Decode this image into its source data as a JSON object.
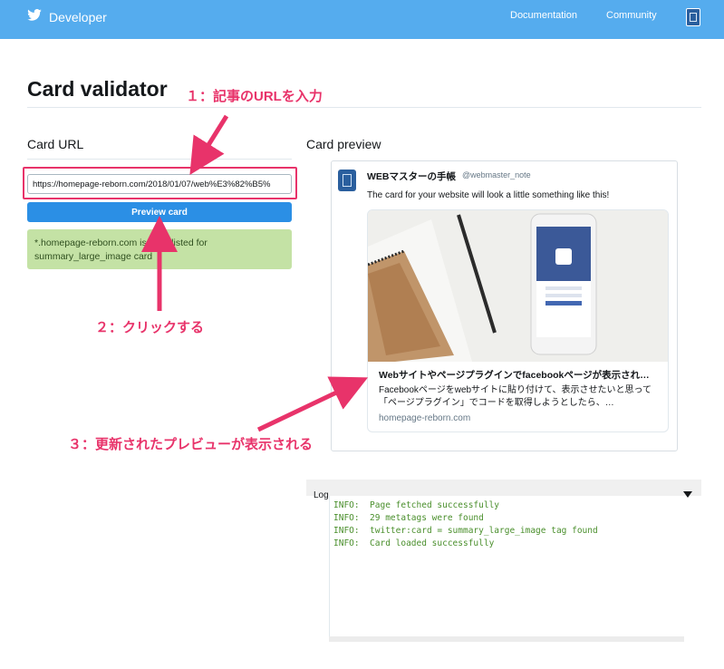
{
  "header": {
    "brand": "Developer",
    "nav": [
      "Documentation",
      "Community"
    ]
  },
  "page_title": "Card validator",
  "left": {
    "section_label": "Card URL",
    "url_value": "https://homepage-reborn.com/2018/01/07/web%E3%82%B5%",
    "button_label": "Preview card",
    "message": "*.homepage-reborn.com is whitelisted for summary_large_image card"
  },
  "right": {
    "section_label": "Card preview",
    "account_name": "WEBマスターの手帳",
    "account_handle": "@webmaster_note",
    "tweet_text": "The card for your website will look a little something like this!",
    "card_title": "Webサイトやページプラグインでfacebookページが表示され…",
    "card_description": "Facebookページをwebサイトに貼り付けて、表示させたいと思って「ページプラグイン」でコードを取得しようとしたら、…",
    "card_domain": "homepage-reborn.com"
  },
  "log": {
    "label": "Log",
    "lines": [
      "INFO:  Page fetched successfully",
      "INFO:  29 metatags were found",
      "INFO:  twitter:card = summary_large_image tag found",
      "INFO:  Card loaded successfully"
    ]
  },
  "annotations": {
    "step1": "１：記事のURLを入力",
    "step2": "２：クリックする",
    "step3": "３：更新されたプレビューが表示される"
  },
  "colors": {
    "header_bg": "#55acee",
    "button_bg": "#2b8fe5",
    "success_bg": "#c4e2a5",
    "annotation": "#e8336a",
    "log_text": "#4a8f2c"
  }
}
